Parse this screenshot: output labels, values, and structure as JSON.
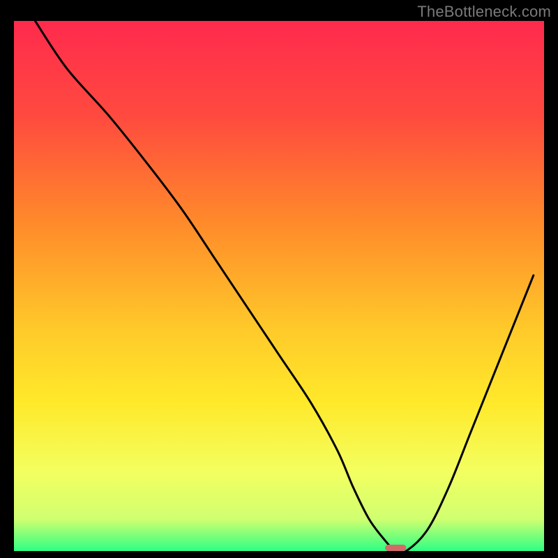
{
  "watermark": "TheBottleneck.com",
  "chart_data": {
    "type": "line",
    "title": "",
    "xlabel": "",
    "ylabel": "",
    "xlim": [
      0,
      100
    ],
    "ylim": [
      0,
      100
    ],
    "grid": false,
    "legend": false,
    "colors": {
      "top": "#ff2a4d",
      "mid_upper": "#ff8a2a",
      "mid": "#ffd92a",
      "mid_lower": "#f4ff66",
      "bottom": "#2dff84",
      "line": "#000000",
      "marker": "#d36a6a"
    },
    "series": [
      {
        "name": "curve",
        "x": [
          4,
          10,
          18,
          26,
          32,
          38,
          44,
          50,
          56,
          61,
          64,
          67,
          70,
          72,
          74,
          78,
          82,
          86,
          90,
          94,
          98
        ],
        "y": [
          100,
          91,
          82,
          72,
          64,
          55,
          46,
          37,
          28,
          19,
          12,
          6,
          2,
          0,
          0,
          4,
          12,
          22,
          32,
          42,
          52
        ]
      }
    ],
    "marker": {
      "x": 72,
      "y": 0,
      "w": 4,
      "h": 1.2
    }
  }
}
